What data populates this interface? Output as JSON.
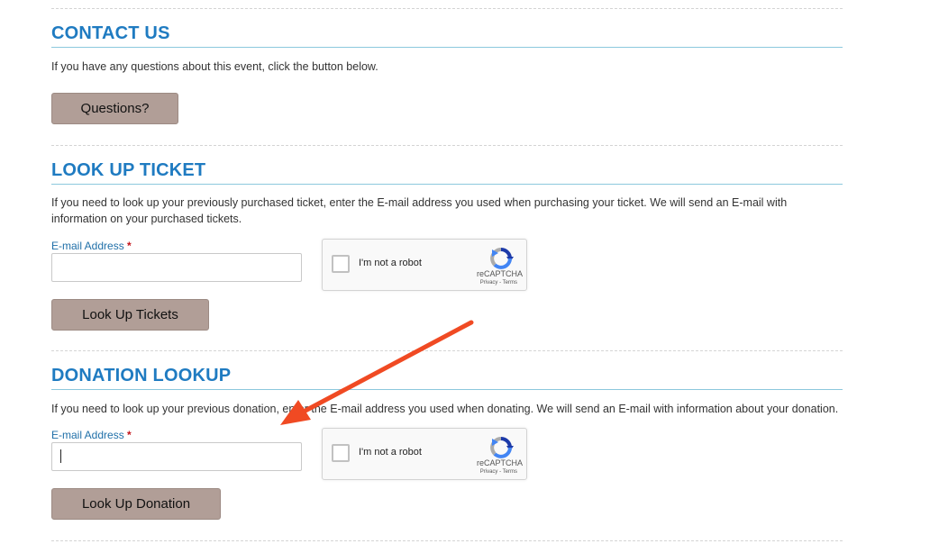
{
  "contact": {
    "heading": "CONTACT US",
    "description": "If you have any questions about this event, click the button below.",
    "button_label": "Questions?"
  },
  "lookup_ticket": {
    "heading": "LOOK UP TICKET",
    "description": "If you need to look up your previously purchased ticket, enter the E-mail address you used when purchasing your ticket. We will send an E-mail with information on your purchased tickets.",
    "email_label": "E-mail Address",
    "required_marker": "*",
    "email_value": "",
    "button_label": "Look Up Tickets"
  },
  "donation_lookup": {
    "heading": "DONATION LOOKUP",
    "description": "If you need to look up your previous donation, enter the E-mail address you used when donating. We will send an E-mail with information about your donation.",
    "email_label": "E-mail Address",
    "required_marker": "*",
    "email_value": "",
    "button_label": "Look Up Donation"
  },
  "captcha": {
    "checkbox_label": "I'm not a robot",
    "brand": "reCAPTCHA",
    "terms": "Privacy - Terms"
  },
  "colors": {
    "heading": "#1f7bc1",
    "button": "#b19e97",
    "annotation_arrow": "#f04a23",
    "required": "#c4161c"
  }
}
